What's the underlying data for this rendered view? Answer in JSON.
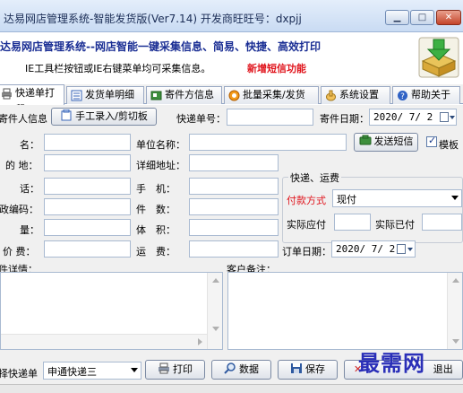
{
  "window": {
    "title": "达易网店管理系统-智能发货版(Ver7.14) 开发商旺旺号：dxpjj"
  },
  "banner": {
    "title": "达易网店管理系统--网店智能一键采集信息、简易、快捷、高效打印",
    "tip": "IE工具栏按钮或IE右键菜单均可采集信息。",
    "new_feature": "新增短信功能"
  },
  "tabs": [
    {
      "label": "快递单打印",
      "icon": "printer-icon",
      "active": true
    },
    {
      "label": "发货单明细",
      "icon": "document-list-icon",
      "active": false
    },
    {
      "label": "寄件方信息",
      "icon": "contact-card-icon",
      "active": false
    },
    {
      "label": "批量采集/发货",
      "icon": "orange-circle-icon",
      "active": false
    },
    {
      "label": "系统设置",
      "icon": "settings-hand-icon",
      "active": false
    },
    {
      "label": "帮助关于",
      "icon": "help-icon",
      "active": false
    }
  ],
  "toolbar": {
    "sender_info_label": "寄件人信息",
    "manual_entry_button": "手工录入/剪切板",
    "tracking_no_label": "快递单号：",
    "tracking_no_value": "",
    "ship_date_label": "寄件日期：",
    "ship_date_value": "2020/ 7/ 2"
  },
  "form": {
    "name_label": "名：",
    "company_label": "单位名称：",
    "send_sms_button": "发送短信",
    "template_checkbox": "模板",
    "template_checked": true,
    "destination_label": "的 地：",
    "address_label": "详细地址：",
    "phone_label": "话：",
    "mobile_label": "手　机：",
    "postcode_label": "政编码：",
    "pieces_label": "件　数：",
    "weight_label": "量：",
    "volume_label": "体　积：",
    "value_label": "价 费：",
    "freight_label": "运　费：",
    "item_details_label": "件详情：",
    "customer_note_label": "客户备注："
  },
  "express_group": {
    "title": "快递、运费",
    "payment_label": "付款方式",
    "payment_value": "现付",
    "actual_payable_label": "实际应付",
    "actual_paid_label": "实际已付",
    "order_date_label": "订单日期：",
    "order_date_value": "2020/ 7/ 2"
  },
  "bottom": {
    "choose_template_label": "择快递单",
    "template_value": "申通快递三",
    "print_button": "打印",
    "data_button": "数据",
    "save_button": "保存",
    "close_button": "退出",
    "watermark": "最需网"
  },
  "colors": {
    "banner_title": "#1a2e94",
    "new_feature": "#e0141c",
    "window_frame": "#c9dbf3"
  }
}
